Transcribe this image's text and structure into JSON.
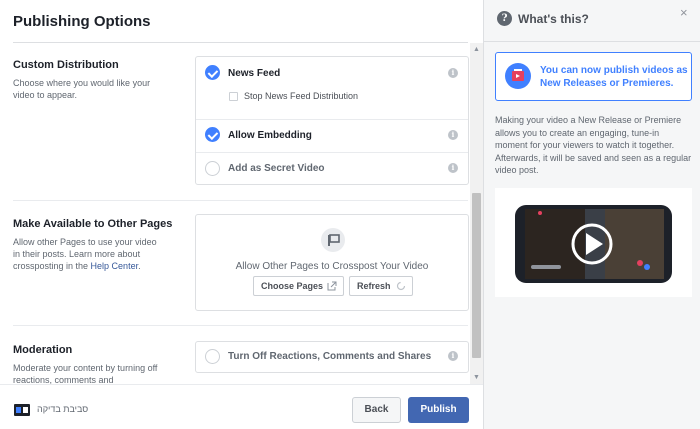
{
  "dialog": {
    "title": "Publishing Options"
  },
  "custom_distribution": {
    "title": "Custom Distribution",
    "description": "Choose where you would like your video to appear.",
    "news_feed": "News Feed",
    "stop_news_feed": "Stop News Feed Distribution",
    "allow_embedding": "Allow Embedding",
    "secret_video": "Add as Secret Video",
    "info_glyph": "i"
  },
  "other_pages": {
    "title": "Make Available to Other Pages",
    "description": "Allow other Pages to use your video in their posts. Learn more about crossposting in the ",
    "help_link": "Help Center",
    "description_end": ".",
    "crosspost_text": "Allow Other Pages to Crosspost Your Video",
    "choose_pages": "Choose Pages",
    "refresh": "Refresh"
  },
  "moderation": {
    "title": "Moderation",
    "description": "Moderate your content by turning off reactions, comments and",
    "turn_off": "Turn Off Reactions, Comments and Shares"
  },
  "footer": {
    "brand_text": "סביבת בדיקה",
    "back": "Back",
    "publish": "Publish"
  },
  "help_panel": {
    "title": "What's this?",
    "close": "×",
    "promo": "You can now publish videos as New Releases or Premieres.",
    "body": "Making your video a New Release or Premiere allows you to create an engaging, tune-in moment for your viewers to watch it together. Afterwards, it will be saved and seen as a regular video post."
  },
  "state": {
    "news_feed_checked": true,
    "stop_news_feed_checked": false,
    "allow_embedding_checked": true,
    "secret_video_checked": false,
    "turn_off_checked": false
  },
  "colors": {
    "accent": "#4080ff",
    "primary_button": "#4267b2",
    "link": "#365899"
  },
  "icons": [
    "check-icon",
    "info-icon",
    "crosspost-icon",
    "external-link-icon",
    "refresh-icon",
    "help-icon",
    "close-icon",
    "premiere-icon",
    "play-icon",
    "brand-logo"
  ]
}
